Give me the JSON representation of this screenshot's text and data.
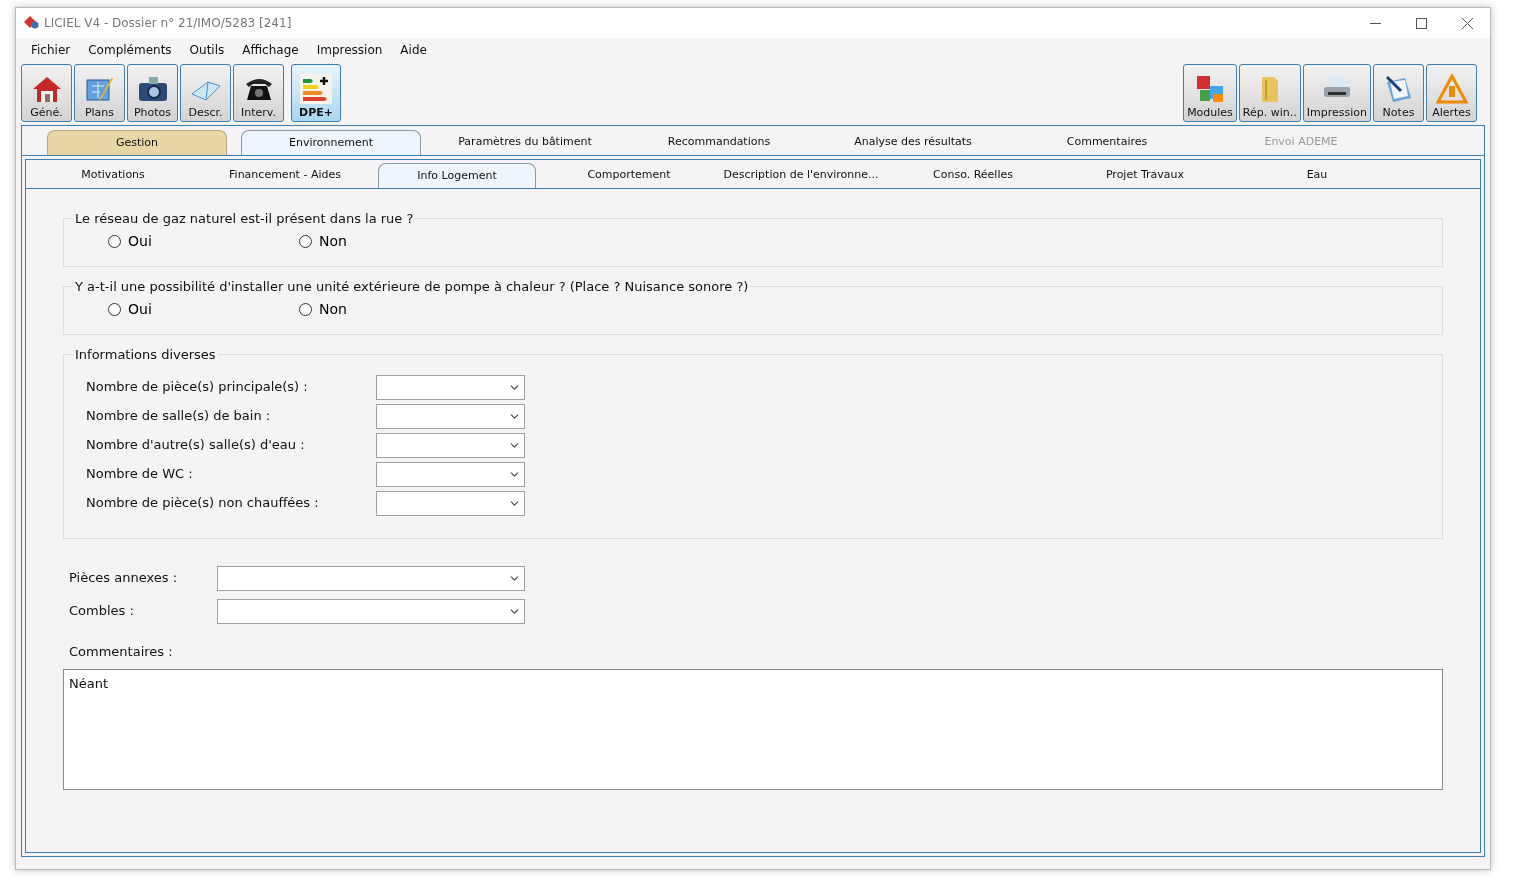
{
  "window": {
    "title": "LICIEL V4 - Dossier n° 21/IMO/5283 [241]"
  },
  "menu": [
    "Fichier",
    "Compléments",
    "Outils",
    "Affichage",
    "Impression",
    "Aide"
  ],
  "toolbar_left": [
    {
      "label": "Géné.",
      "selected": false
    },
    {
      "label": "Plans",
      "selected": false
    },
    {
      "label": "Photos",
      "selected": false
    },
    {
      "label": "Descr.",
      "selected": false
    },
    {
      "label": "Interv.",
      "selected": false
    },
    {
      "label": "DPE+",
      "selected": true
    }
  ],
  "toolbar_right": [
    {
      "label": "Modules"
    },
    {
      "label": "Rép. win.."
    },
    {
      "label": "Impression"
    },
    {
      "label": "Notes"
    },
    {
      "label": "Alertes"
    }
  ],
  "tabs": [
    {
      "label": "Gestion",
      "selected": false,
      "disabled": false,
      "color": "#e8d6a4"
    },
    {
      "label": "Environnement",
      "selected": true,
      "disabled": false
    },
    {
      "label": "Paramètres du bâtiment",
      "selected": false,
      "disabled": false
    },
    {
      "label": "Recommandations",
      "selected": false,
      "disabled": false
    },
    {
      "label": "Analyse des résultats",
      "selected": false,
      "disabled": false
    },
    {
      "label": "Commentaires",
      "selected": false,
      "disabled": false
    },
    {
      "label": "Envoi ADEME",
      "selected": false,
      "disabled": true
    }
  ],
  "subtabs": [
    {
      "label": "Motivations",
      "selected": false
    },
    {
      "label": "Financement  - Aides",
      "selected": false
    },
    {
      "label": "Info Logement",
      "selected": true
    },
    {
      "label": "Comportement",
      "selected": false
    },
    {
      "label": "Description de l'environne...",
      "selected": false
    },
    {
      "label": "Conso. Réelles",
      "selected": false
    },
    {
      "label": "Projet Travaux",
      "selected": false
    },
    {
      "label": "Eau",
      "selected": false
    }
  ],
  "questions": [
    {
      "legend": "Le réseau de gaz naturel est-il présent dans la rue ?",
      "options": [
        {
          "label": "Oui",
          "selected": false
        },
        {
          "label": "Non",
          "selected": false
        }
      ]
    },
    {
      "legend": "Y a-t-il une possibilité d'installer une unité extérieure de pompe à chaleur ? (Place ? Nuisance sonore ?)",
      "options": [
        {
          "label": "Oui",
          "selected": false
        },
        {
          "label": "Non",
          "selected": false
        }
      ]
    }
  ],
  "informations": {
    "legend": "Informations diverses",
    "fields": [
      {
        "label": "Nombre de pièce(s) principale(s) :"
      },
      {
        "label": "Nombre de salle(s) de bain :"
      },
      {
        "label": "Nombre d'autre(s) salle(s) d'eau :"
      },
      {
        "label": "Nombre de WC :"
      },
      {
        "label": "Nombre de pièce(s) non chauffées :"
      }
    ]
  },
  "extra_fields": [
    {
      "label": "Pièces annexes :"
    },
    {
      "label": "Combles :"
    }
  ],
  "comments": {
    "label": "Commentaires :",
    "value": "Néant"
  }
}
